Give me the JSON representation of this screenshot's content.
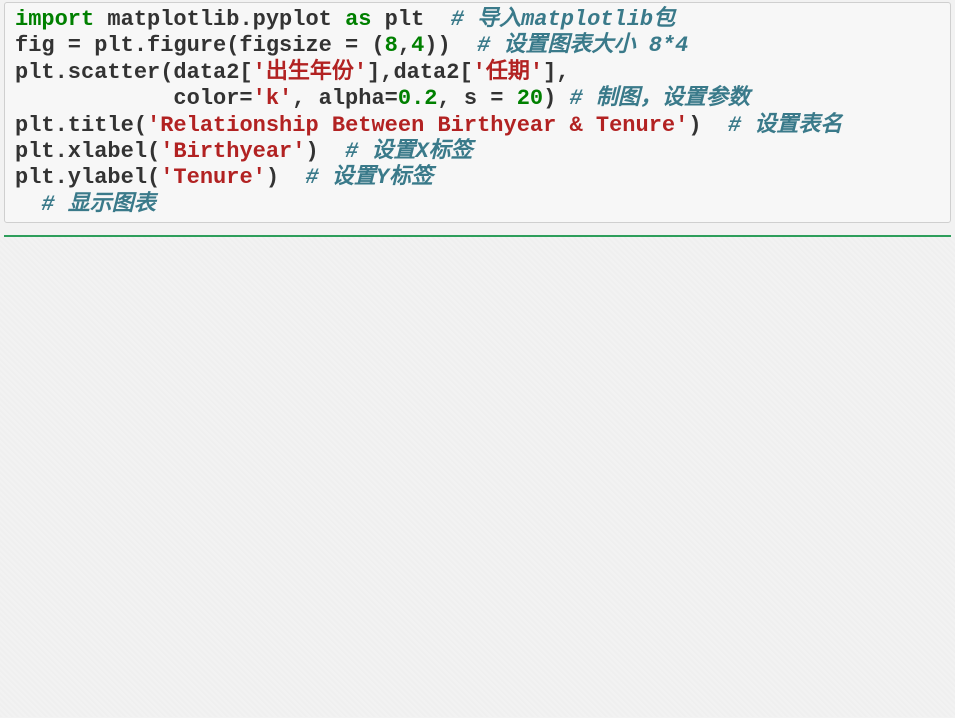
{
  "code": {
    "l1_import": "import",
    "l1_mod": " matplotlib.pyplot ",
    "l1_as": "as",
    "l1_alias": " plt  ",
    "l1_cmt": "# 导入matplotlib包",
    "l2_a": "fig = plt.figure(figsize = (",
    "l2_n1": "8",
    "l2_comma": ",",
    "l2_n2": "4",
    "l2_b": "))  ",
    "l2_cmt": "# 设置图表大小 8*4",
    "l3_a": "plt.scatter(data2[",
    "l3_s1": "'出生年份'",
    "l3_b": "],data2[",
    "l3_s2": "'任期'",
    "l3_c": "],",
    "l4_pad": "            color=",
    "l4_s1": "'k'",
    "l4_mid": ", alpha=",
    "l4_n1": "0.2",
    "l4_mid2": ", s = ",
    "l4_n2": "20",
    "l4_end": ") ",
    "l4_cmt": "# 制图，设置参数",
    "l5_a": "plt.title(",
    "l5_s1": "'Relationship Between Birthyear & Tenure'",
    "l5_b": ")  ",
    "l5_cmt": "# 设置表名",
    "l6_a": "plt.xlabel(",
    "l6_s1": "'Birthyear'",
    "l6_b": ")  ",
    "l6_cmt": "# 设置X标签",
    "l7_a": "plt.ylabel(",
    "l7_s1": "'Tenure'",
    "l7_b": ")  ",
    "l7_cmt": "# 设置Y标签",
    "l8_pad": "  ",
    "l8_cmt": "# 显示图表"
  }
}
